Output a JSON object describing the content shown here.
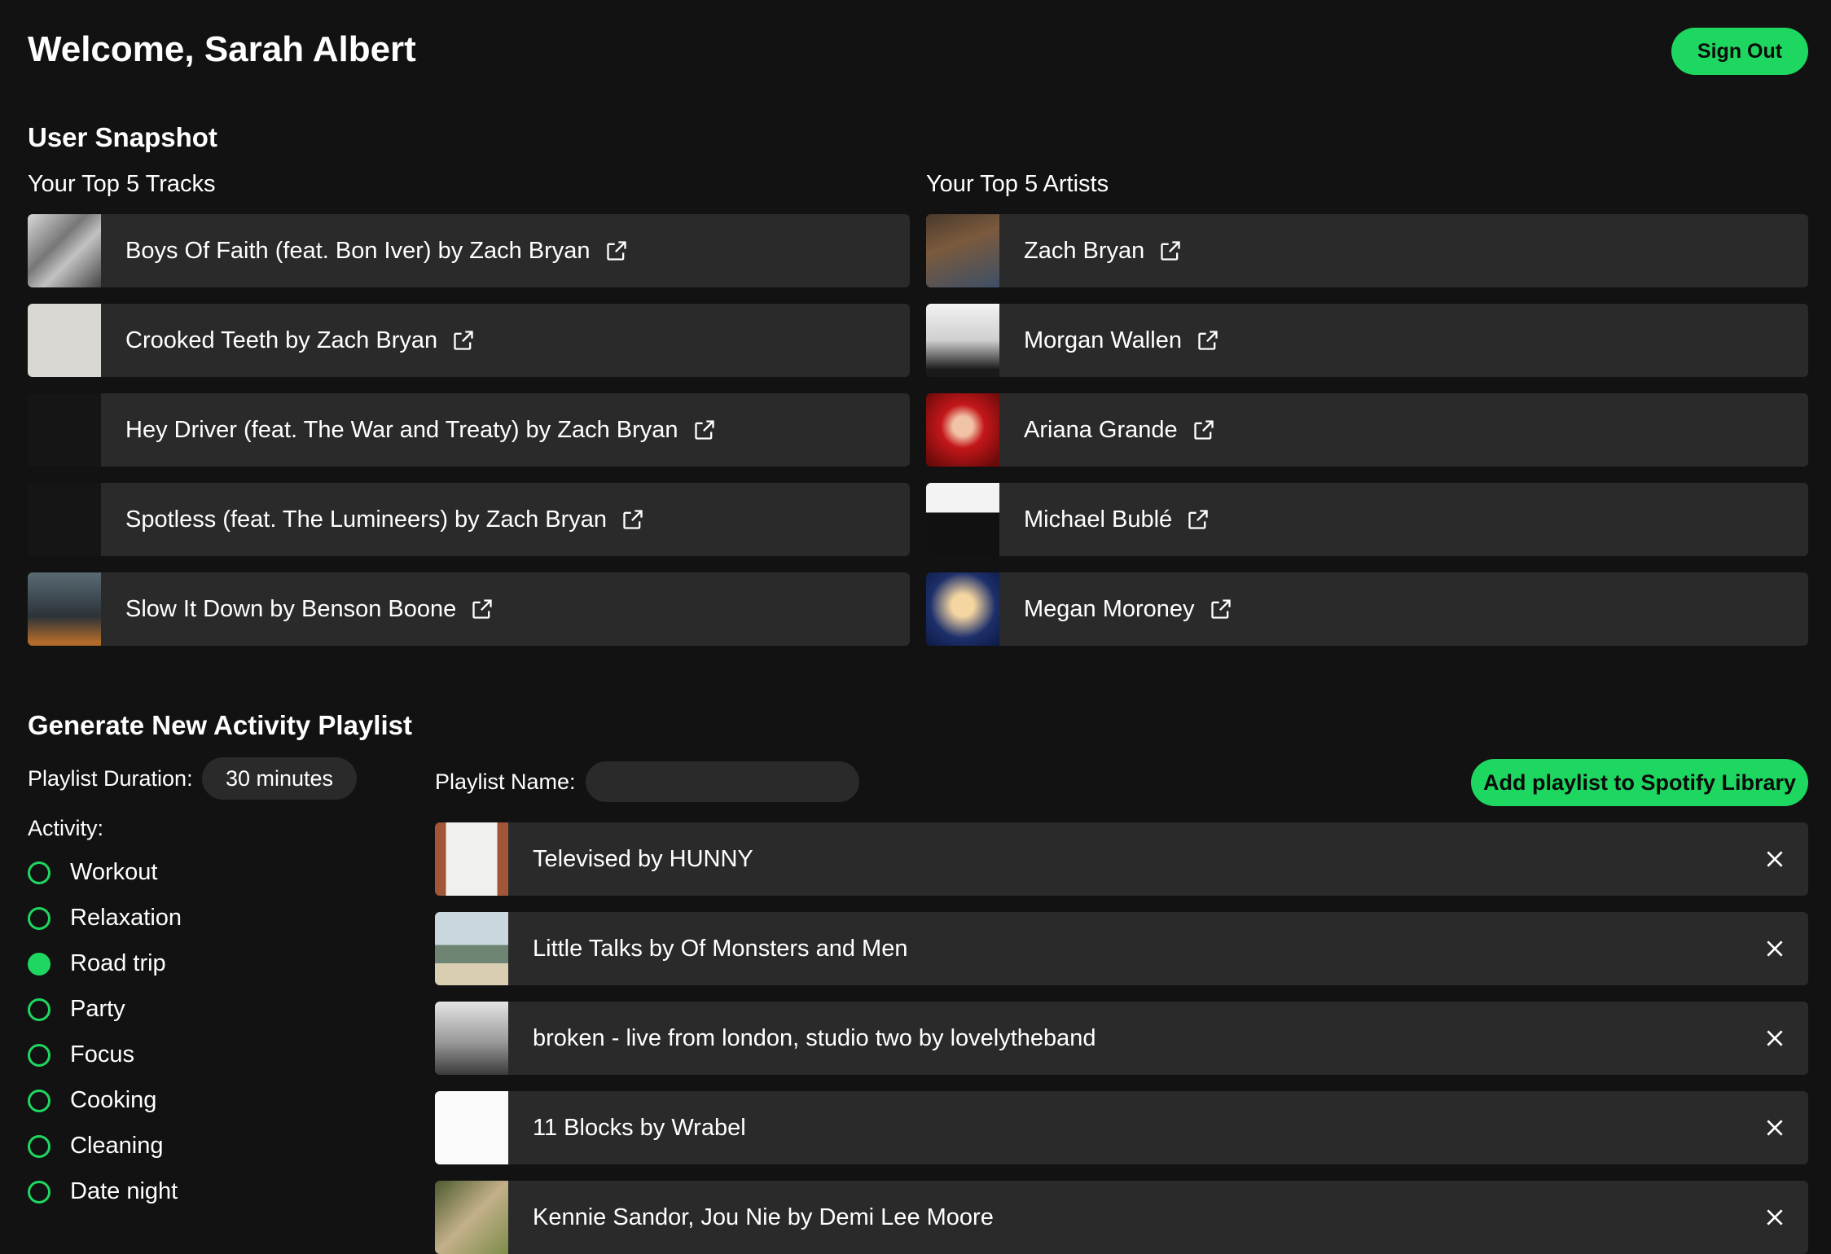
{
  "header": {
    "welcome": "Welcome, Sarah Albert",
    "sign_out": "Sign Out"
  },
  "snapshot": {
    "title": "User Snapshot",
    "tracks_title": "Your Top 5 Tracks",
    "artists_title": "Your Top 5 Artists",
    "tracks": [
      {
        "label": "Boys Of Faith (feat. Bon Iver) by Zach Bryan"
      },
      {
        "label": "Crooked Teeth by Zach Bryan"
      },
      {
        "label": "Hey Driver (feat. The War and Treaty) by Zach Bryan"
      },
      {
        "label": "Spotless (feat. The Lumineers) by Zach Bryan"
      },
      {
        "label": "Slow It Down by Benson Boone"
      }
    ],
    "artists": [
      {
        "label": "Zach Bryan"
      },
      {
        "label": "Morgan Wallen"
      },
      {
        "label": "Ariana Grande"
      },
      {
        "label": "Michael Bublé"
      },
      {
        "label": "Megan Moroney"
      }
    ]
  },
  "generator": {
    "title": "Generate New Activity Playlist",
    "duration_label": "Playlist Duration:",
    "duration_value": "30 minutes",
    "activity_label": "Activity:",
    "activities": [
      {
        "label": "Workout",
        "selected": false
      },
      {
        "label": "Relaxation",
        "selected": false
      },
      {
        "label": "Road trip",
        "selected": true
      },
      {
        "label": "Party",
        "selected": false
      },
      {
        "label": "Focus",
        "selected": false
      },
      {
        "label": "Cooking",
        "selected": false
      },
      {
        "label": "Cleaning",
        "selected": false
      },
      {
        "label": "Date night",
        "selected": false
      }
    ],
    "name_label": "Playlist Name:",
    "name_value": "",
    "add_button": "Add playlist to Spotify Library",
    "playlist": [
      {
        "label": "Televised by HUNNY"
      },
      {
        "label": "Little Talks by Of Monsters and Men"
      },
      {
        "label": "broken - live from london, studio two by lovelytheband"
      },
      {
        "label": "11 Blocks by Wrabel"
      },
      {
        "label": "Kennie Sandor, Jou Nie by Demi Lee Moore"
      }
    ]
  },
  "colors": {
    "accent": "#1ed760",
    "background": "#121212",
    "card": "#2a2a2a"
  },
  "icons": {
    "external": "external-link-icon",
    "remove": "close-icon"
  }
}
